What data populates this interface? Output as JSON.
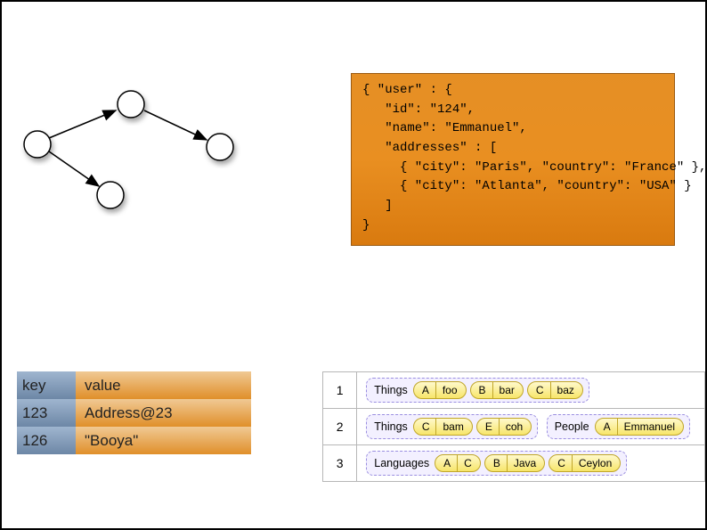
{
  "json_box": {
    "l1": "{ \"user\" : {",
    "l2": "   \"id\": \"124\",",
    "l3": "   \"name\": \"Emmanuel\",",
    "l4": "   \"addresses\" : [",
    "l5": "     { \"city\": \"Paris\", \"country\": \"France\" },",
    "l6": "     { \"city\": \"Atlanta\", \"country\": \"USA\" }",
    "l7": "   ]",
    "l8": "}"
  },
  "kv": {
    "header_key": "key",
    "header_val": "value",
    "rows": [
      {
        "key": "123",
        "val": "Address@23"
      },
      {
        "key": "126",
        "val": "\"Booya\""
      }
    ]
  },
  "ft": {
    "rows": [
      {
        "idx": "1",
        "groups": [
          {
            "name": "Things",
            "pills": [
              {
                "k": "A",
                "v": "foo"
              },
              {
                "k": "B",
                "v": "bar"
              },
              {
                "k": "C",
                "v": "baz"
              }
            ]
          }
        ]
      },
      {
        "idx": "2",
        "groups": [
          {
            "name": "Things",
            "pills": [
              {
                "k": "C",
                "v": "bam"
              },
              {
                "k": "E",
                "v": "coh"
              }
            ]
          },
          {
            "name": "People",
            "pills": [
              {
                "k": "A",
                "v": "Emmanuel"
              }
            ]
          }
        ]
      },
      {
        "idx": "3",
        "groups": [
          {
            "name": "Languages",
            "pills": [
              {
                "k": "A",
                "v": "C"
              },
              {
                "k": "B",
                "v": "Java"
              },
              {
                "k": "C",
                "v": "Ceylon"
              }
            ]
          }
        ]
      }
    ]
  }
}
